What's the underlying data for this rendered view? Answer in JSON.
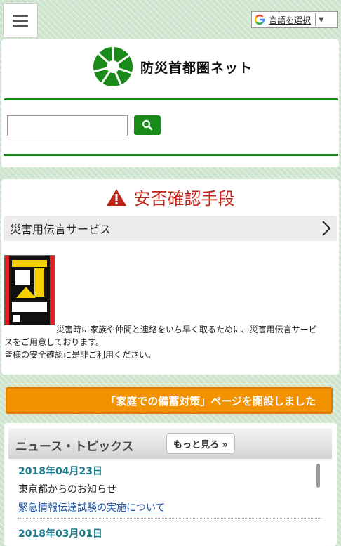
{
  "translate": {
    "label": "言語を選択"
  },
  "header": {
    "site_name": "防災首都圏ネット"
  },
  "safety": {
    "heading": "安否確認手段",
    "service_label": "災害用伝言サービス",
    "desc_line1": "災害時に家族や仲間と連絡をいち早く取るために、災害用伝言サービ",
    "desc_line2": "スをご用意しております。",
    "desc_line3": "皆様の安全確認に是非ご利用ください。"
  },
  "banner": {
    "text": "「家庭での備蓄対策」ページを開設しました"
  },
  "news": {
    "title": "ニュース・トピックス",
    "more_label": "もっと見る »",
    "items": [
      {
        "date": "2018年04月23日",
        "source": "東京都からのお知らせ",
        "link": "緊急情報伝達試験の実施について"
      },
      {
        "date": "2018年03月01日"
      }
    ]
  },
  "colors": {
    "brand_green": "#1a8a1a",
    "alert_red": "#c0251b",
    "banner_orange": "#f39200"
  }
}
